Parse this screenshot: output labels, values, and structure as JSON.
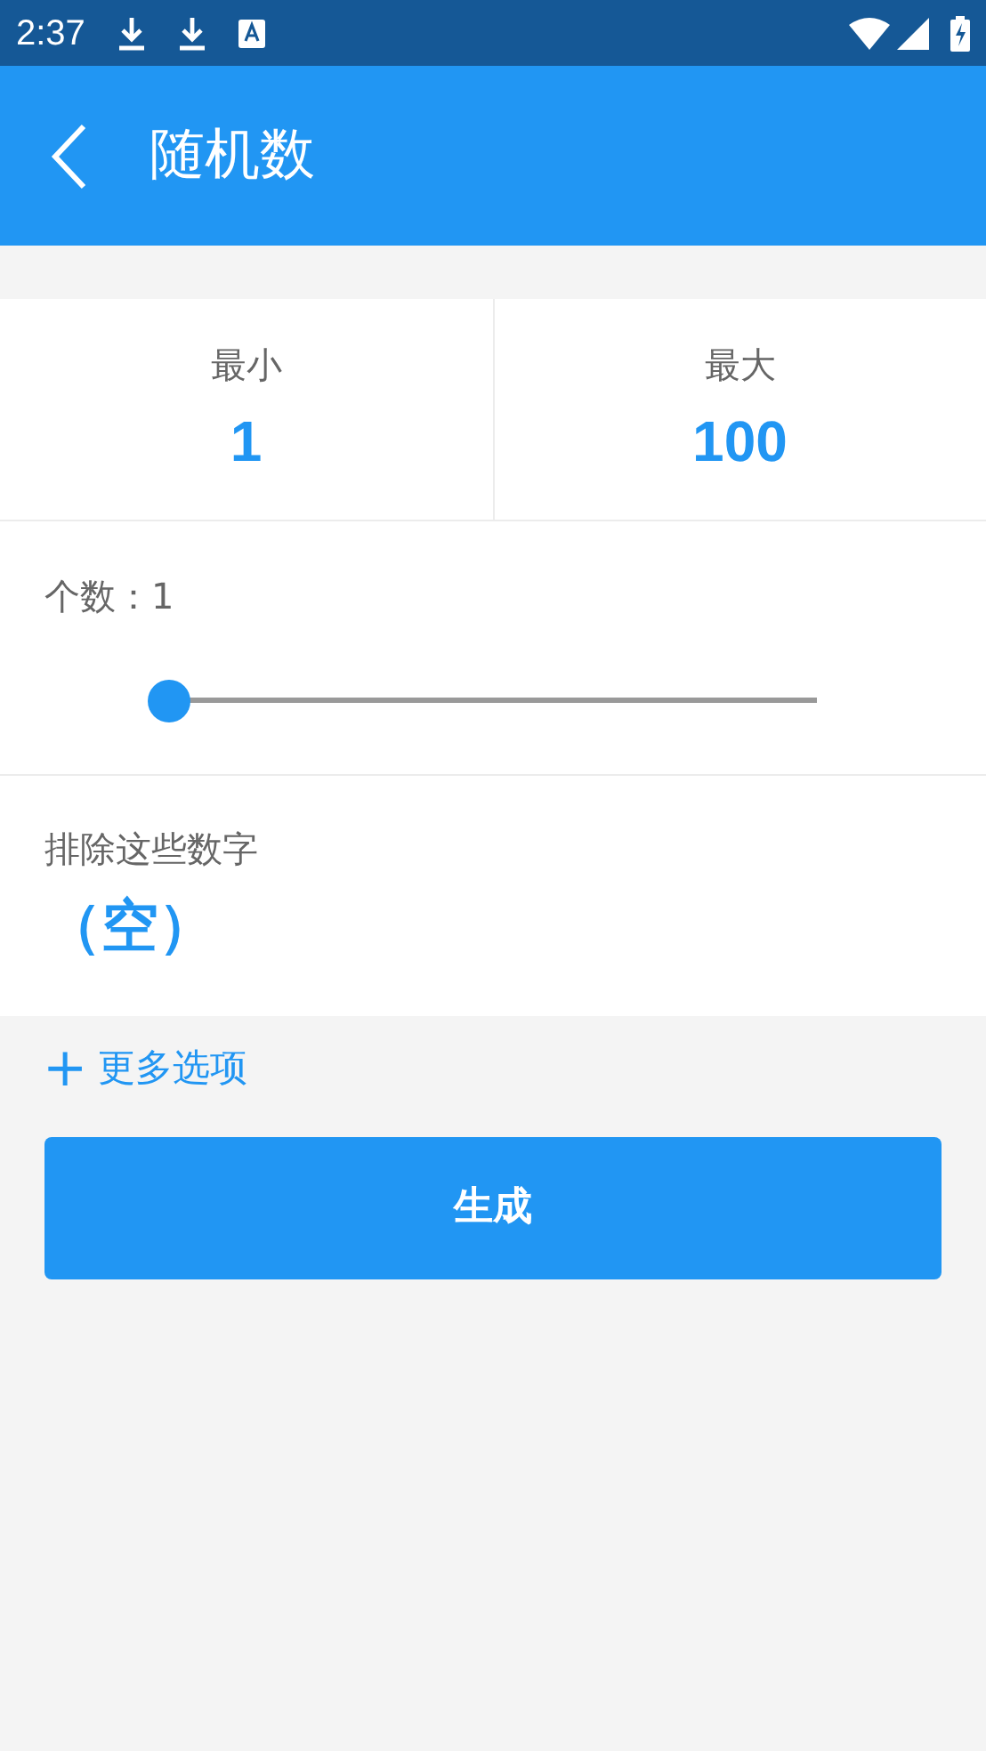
{
  "status_bar": {
    "time": "2:37"
  },
  "app_bar": {
    "title": "随机数"
  },
  "range": [
    {
      "label": "最小",
      "value": "1"
    },
    {
      "label": "最大",
      "value": "100"
    }
  ],
  "count": {
    "label": "个数：1",
    "level": 0
  },
  "exclude": {
    "label": "排除这些数字",
    "value": "（空）"
  },
  "more_options": {
    "icon": "+",
    "label": "更多选项"
  },
  "generate_button": {
    "label": "生成"
  }
}
